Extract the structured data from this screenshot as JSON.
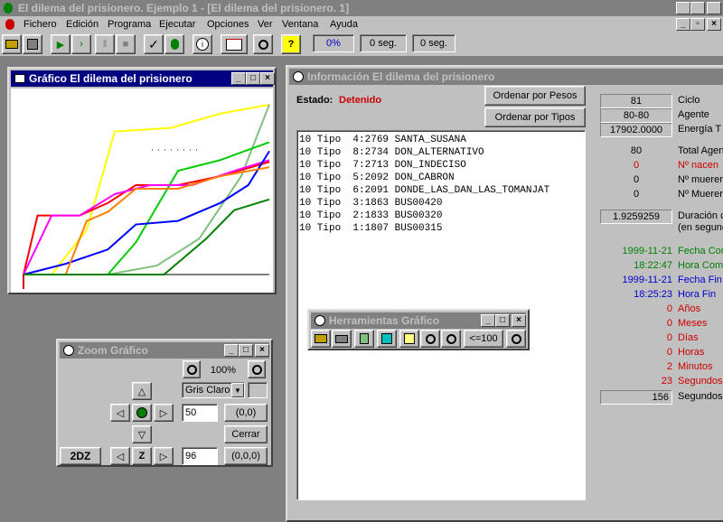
{
  "app": {
    "title": "El dilema del prisionero. Ejemplo 1 - [El dilema del prisionero. 1]"
  },
  "menu": [
    "Fichero",
    "Edición",
    "Programa",
    "Ejecutar",
    "Opciones",
    "Ver",
    "Ventana",
    "Ayuda"
  ],
  "toolbar": {
    "percent": "0%",
    "elapsed1": "0 seg.",
    "elapsed2": "0 seg."
  },
  "graph": {
    "title": "Gráfico El dilema del prisionero"
  },
  "zoom": {
    "title": "Zoom Gráfico",
    "zoom_value": "100%",
    "palette": "Gris Claro",
    "field1": "50",
    "field2": "96",
    "coord1": "(0,0)",
    "coord2": "(0,0,0)",
    "close": "Cerrar",
    "two_dz": "2DZ",
    "z": "Z"
  },
  "info": {
    "title": "Información El dilema del prisionero",
    "estado_label": "Estado:",
    "estado_value": "Detenido",
    "sort_weights": "Ordenar por Pesos",
    "sort_types": "Ordenar por Tipos",
    "list": [
      "10 Tipo  4:2769 SANTA_SUSANA",
      "10 Tipo  8:2734 DON_ALTERNATIVO",
      "10 Tipo  7:2713 DON_INDECISO",
      "10 Tipo  5:2092 DON_CABRON",
      "10 Tipo  6:2091 DONDE_LAS_DAN_LAS_TOMANJAT",
      "10 Tipo  3:1863 BUS00420",
      "10 Tipo  2:1833 BUS00320",
      "10 Tipo  1:1807 BUS00315"
    ],
    "stats": {
      "ciclo": "81",
      "ciclo_label": "Ciclo",
      "agente": "80-80",
      "agente_label": "Agente",
      "energia": "17902.0000",
      "energia_label": "Energía T",
      "total": "80",
      "total_label": "Total Agen",
      "nacen": "0",
      "nacen_label": "Nº nacen",
      "mueren1": "0",
      "mueren1_label": "Nº muerer",
      "mueren2": "0",
      "mueren2_label": "Nº Muerer",
      "duracion": "1.9259259",
      "duracion_label": "Duración c",
      "duracion_label2": "(en segunc",
      "fecha_com": "1999-11-21",
      "fecha_com_label": "Fecha Com",
      "hora_com": "18:22:47",
      "hora_com_label": "Hora Comi",
      "fecha_fin": "1999-11-21",
      "fecha_fin_label": "Fecha Fin",
      "hora_fin": "18:25:23",
      "hora_fin_label": "Hora Fin",
      "anos": "0",
      "anos_label": "Años",
      "meses": "0",
      "meses_label": "Meses",
      "dias": "0",
      "dias_label": "Días",
      "horas": "0",
      "horas_label": "Horas",
      "minutos": "2",
      "minutos_label": "Minutos",
      "segundos": "23",
      "segundos_label": "Segundos",
      "segundos_total": "156",
      "segundos_total_label": "Segundos"
    }
  },
  "tools": {
    "title": "Herramientas Gráfico",
    "range": "<=100"
  },
  "colors": {
    "title_active": "#000080",
    "title_inactive": "#808080",
    "estado": "#cc0000",
    "green": "#008000",
    "blue": "#0000cc",
    "red": "#cc0000"
  },
  "chart_data": {
    "type": "line",
    "series": [
      {
        "color": "#ffff00",
        "values": [
          [
            0,
            0
          ],
          [
            4,
            0
          ],
          [
            9,
            25
          ],
          [
            13,
            80
          ],
          [
            21,
            82
          ],
          [
            28,
            90
          ],
          [
            35,
            95
          ]
        ]
      },
      {
        "color": "#80c080",
        "values": [
          [
            0,
            0
          ],
          [
            4,
            0
          ],
          [
            12,
            0
          ],
          [
            19,
            5
          ],
          [
            25,
            20
          ],
          [
            31,
            55
          ],
          [
            35,
            95
          ]
        ]
      },
      {
        "color": "#00cc00",
        "values": [
          [
            0,
            0
          ],
          [
            4,
            0
          ],
          [
            12,
            0
          ],
          [
            16,
            18
          ],
          [
            22,
            58
          ],
          [
            28,
            64
          ],
          [
            35,
            74
          ]
        ]
      },
      {
        "color": "#ff0000",
        "values": [
          [
            0,
            0
          ],
          [
            2,
            33
          ],
          [
            8,
            33
          ],
          [
            12,
            40
          ],
          [
            16,
            50
          ],
          [
            22,
            50
          ],
          [
            28,
            55
          ],
          [
            35,
            63
          ]
        ]
      },
      {
        "color": "#ff00ff",
        "values": [
          [
            0,
            0
          ],
          [
            4,
            33
          ],
          [
            8,
            33
          ],
          [
            13,
            45
          ],
          [
            18,
            50
          ],
          [
            24,
            50
          ],
          [
            30,
            58
          ],
          [
            35,
            64
          ]
        ]
      },
      {
        "color": "#0000ff",
        "values": [
          [
            0,
            0
          ],
          [
            6,
            6
          ],
          [
            12,
            14
          ],
          [
            16,
            28
          ],
          [
            22,
            30
          ],
          [
            28,
            40
          ],
          [
            32,
            50
          ],
          [
            35,
            69
          ]
        ]
      },
      {
        "color": "#ff8000",
        "values": [
          [
            0,
            0
          ],
          [
            6,
            0
          ],
          [
            9,
            30
          ],
          [
            12,
            35
          ],
          [
            16,
            48
          ],
          [
            22,
            48
          ],
          [
            28,
            55
          ],
          [
            35,
            60
          ]
        ]
      },
      {
        "color": "#008000",
        "values": [
          [
            0,
            0
          ],
          [
            4,
            0
          ],
          [
            12,
            0
          ],
          [
            20,
            0
          ],
          [
            26,
            20
          ],
          [
            30,
            36
          ],
          [
            35,
            42
          ]
        ]
      }
    ],
    "ylim": [
      0,
      100
    ],
    "xlim": [
      0,
      35
    ]
  }
}
